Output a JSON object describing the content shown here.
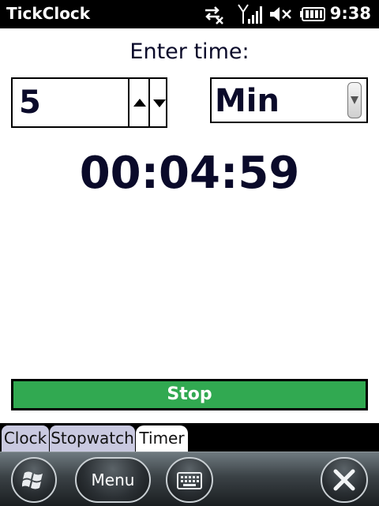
{
  "titlebar": {
    "app_title": "TickClock",
    "time": "9:38",
    "icons": [
      "data-sync-off-icon",
      "signal-strength-icon",
      "speaker-muted-icon",
      "battery-icon"
    ]
  },
  "timer": {
    "prompt": "Enter time:",
    "amount": "5",
    "unit": "Min",
    "countdown": "00:04:59",
    "stop_label": "Stop"
  },
  "tabs": [
    {
      "label": "Clock",
      "active": false
    },
    {
      "label": "Stopwatch",
      "active": false
    },
    {
      "label": "Timer",
      "active": true
    }
  ],
  "softkeys": {
    "menu_label": "Menu",
    "icons": [
      "windows-start-icon",
      "keyboard-icon",
      "close-icon"
    ]
  },
  "colors": {
    "stop_button": "#31a951",
    "text": "#0a0a2a",
    "inactive_tab": "#c9c9e0"
  }
}
